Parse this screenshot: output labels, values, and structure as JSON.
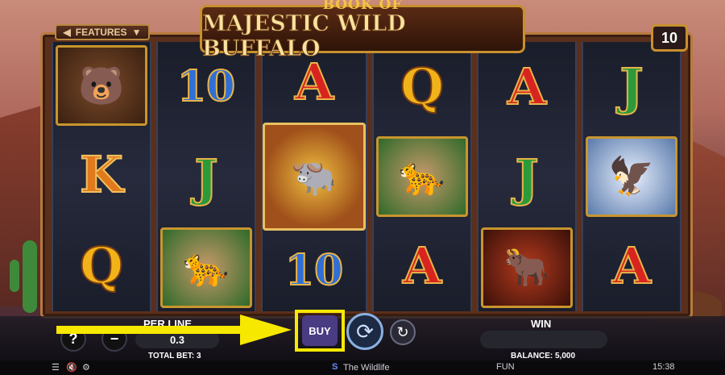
{
  "game": {
    "title_line1": "BOOK OF",
    "title_line2": "MAJESTIC WILD BUFFALO",
    "features_label": "FEATURES",
    "paylines": "10"
  },
  "reels": [
    [
      {
        "type": "pic",
        "name": "bear-symbol",
        "glyph": "🐻",
        "cls": "bear"
      },
      {
        "type": "letter",
        "text": "K",
        "cls": "orange"
      },
      {
        "type": "letter",
        "text": "Q",
        "cls": "gold"
      }
    ],
    [
      {
        "type": "letter",
        "text": "10",
        "cls": "tenc"
      },
      {
        "type": "letter",
        "text": "J",
        "cls": "green"
      },
      {
        "type": "pic",
        "name": "cougar-symbol",
        "glyph": "🐆",
        "cls": "cougar"
      }
    ],
    [
      {
        "type": "letter",
        "text": "A",
        "cls": "red"
      },
      {
        "type": "pic",
        "name": "book-wild-symbol",
        "glyph": "🐃",
        "cls": "book"
      },
      {
        "type": "letter",
        "text": "10",
        "cls": "tenc"
      }
    ],
    [
      {
        "type": "letter",
        "text": "Q",
        "cls": "gold"
      },
      {
        "type": "pic",
        "name": "cougar-symbol",
        "glyph": "🐆",
        "cls": "cougar"
      },
      {
        "type": "letter",
        "text": "A",
        "cls": "red"
      }
    ],
    [
      {
        "type": "letter",
        "text": "A",
        "cls": "red"
      },
      {
        "type": "letter",
        "text": "J",
        "cls": "green"
      },
      {
        "type": "pic",
        "name": "buffalo-symbol",
        "glyph": "🐂",
        "cls": "buffalo"
      }
    ],
    [
      {
        "type": "letter",
        "text": "J",
        "cls": "green"
      },
      {
        "type": "pic",
        "name": "eagle-symbol",
        "glyph": "🦅",
        "cls": "eagle"
      },
      {
        "type": "letter",
        "text": "A",
        "cls": "red"
      }
    ]
  ],
  "hud": {
    "help_label": "?",
    "minus_label": "−",
    "per_line_label": "PER LINE",
    "per_line_value": "0.3",
    "total_bet": "TOTAL BET: 3",
    "buy_label": "BUY",
    "win_label": "WIN",
    "win_value": "",
    "balance": "BALANCE: 5,000"
  },
  "bottom": {
    "provider": "The Wildlife",
    "mode": "FUN",
    "time": "15:38"
  },
  "colors": {
    "highlight": "#f7e800",
    "buy_button": "#4a3c82",
    "frame": "#c8902e"
  }
}
